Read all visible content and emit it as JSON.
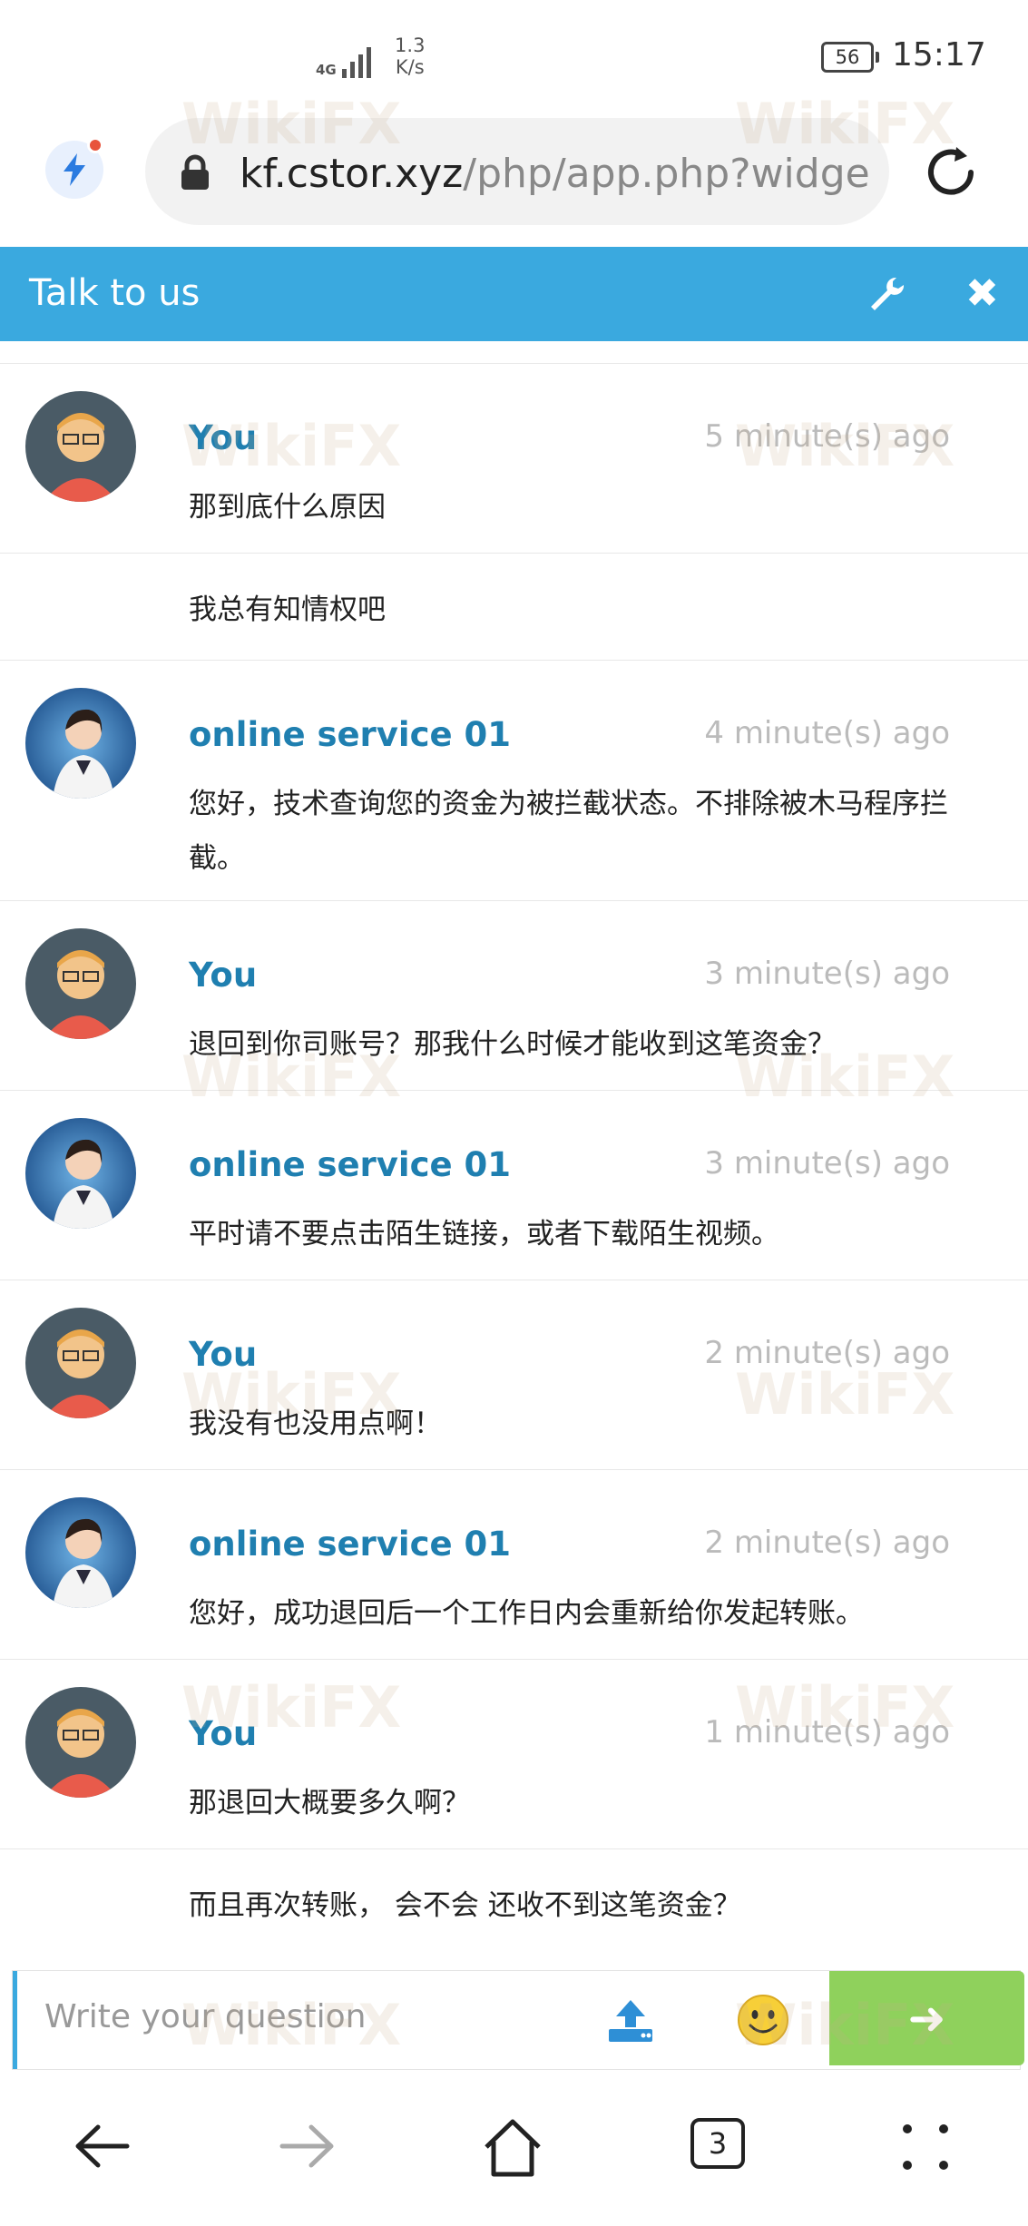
{
  "status_bar": {
    "network": "4G",
    "speed_value": "1.3",
    "speed_unit": "K/s",
    "battery": "56",
    "time": "15:17"
  },
  "browser": {
    "url_host": "kf.cstor.xyz",
    "url_path": "/php/app.php?widge"
  },
  "chat": {
    "title": "Talk to us",
    "messages": [
      {
        "author": "You",
        "time": "5 minute(s) ago",
        "text": "那到底什么原因",
        "avatar": "user"
      },
      {
        "author": "",
        "time": "",
        "text": "我总有知情权吧",
        "avatar": ""
      },
      {
        "author": "online service 01",
        "time": "4 minute(s) ago",
        "text": "您好，技术查询您的资金为被拦截状态。不排除被木马程序拦截。",
        "avatar": "agent"
      },
      {
        "author": "You",
        "time": "3 minute(s) ago",
        "text": "退回到你司账号？那我什么时候才能收到这笔资金？",
        "avatar": "user"
      },
      {
        "author": "online service 01",
        "time": "3 minute(s) ago",
        "text": "平时请不要点击陌生链接，或者下载陌生视频。",
        "avatar": "agent"
      },
      {
        "author": "You",
        "time": "2 minute(s) ago",
        "text": "我没有也没用点啊！",
        "avatar": "user"
      },
      {
        "author": "online service 01",
        "time": "2 minute(s) ago",
        "text": "您好，成功退回后一个工作日内会重新给你发起转账。",
        "avatar": "agent"
      },
      {
        "author": "You",
        "time": "1 minute(s) ago",
        "text": "那退回大概要多久啊？",
        "avatar": "user"
      },
      {
        "author": "",
        "time": "",
        "text": "而且再次转账， 会不会 还收不到这笔资金？",
        "avatar": ""
      }
    ],
    "input_placeholder": "Write your question",
    "send_label": "➜"
  },
  "nav": {
    "tab_count": "3"
  },
  "watermark": "WikiFX",
  "colors": {
    "header_blue": "#3aa9df",
    "author_blue": "#1f7fb0",
    "send_green": "#8fd15c"
  }
}
